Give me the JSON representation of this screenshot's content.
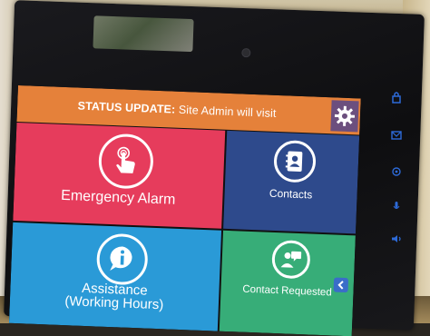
{
  "status_bar": {
    "label": "STATUS UPDATE:",
    "message": "Site Admin will visit"
  },
  "tiles": {
    "emergency": {
      "label": "Emergency Alarm",
      "icon": "touch-hand-icon"
    },
    "contacts": {
      "label": "Contacts",
      "icon": "address-book-icon"
    },
    "assistance": {
      "label_line1": "Assistance",
      "label_line2": "(Working Hours)",
      "icon": "info-bubble-icon"
    },
    "contact_requested": {
      "label": "Contact Requested",
      "icon": "chat-person-icon"
    }
  },
  "icons": {
    "settings": "gear-icon",
    "back": "chevron-left-icon",
    "side_keys": [
      "lock-icon",
      "envelope-icon",
      "phone-icon",
      "mic-icon",
      "speaker-icon"
    ]
  },
  "colors": {
    "status_bar": "#e5813a",
    "settings": "#6c4f7e",
    "emergency": "#e63c5c",
    "contacts": "#2e4a8c",
    "assistance": "#2a9ad7",
    "contact_requested": "#37ad78",
    "side_keys": "#2d6ad8"
  }
}
